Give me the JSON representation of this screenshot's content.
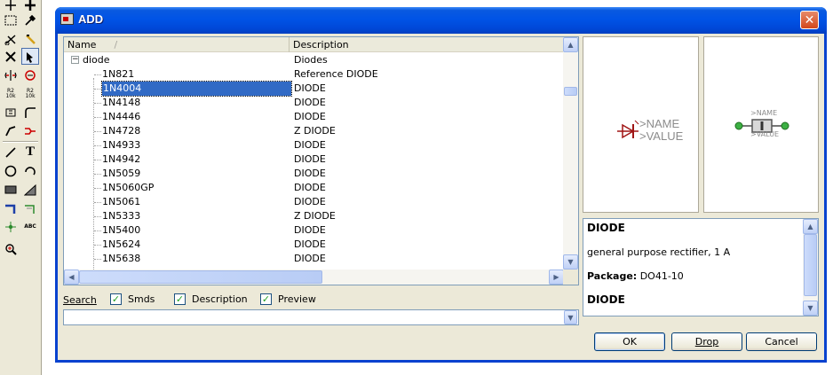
{
  "window": {
    "title": "ADD"
  },
  "toolbar": {
    "tools": [
      "move-icon",
      "copy-icon",
      "group-icon",
      "change-icon",
      "cut-icon",
      "ripup-icon",
      "delete-icon",
      "add-icon",
      "mirror-icon",
      "rotate-icon",
      "name-icon",
      "value-icon",
      "smash-icon",
      "miter-icon",
      "split-icon",
      "optimize-icon",
      "wire-icon",
      "text-icon",
      "circle-icon",
      "arc-icon",
      "rect-icon",
      "polygon-icon",
      "bus-icon",
      "net-icon",
      "junction-icon",
      "label-icon",
      "erc-icon"
    ],
    "name_glyph": "R2\n10k",
    "text_glyph": "T",
    "label_glyph": "ABC"
  },
  "list": {
    "columns": {
      "name": "Name",
      "description": "Description"
    },
    "sort_glyph": "/",
    "group": {
      "name": "diode",
      "description": "Diodes",
      "expander": "−"
    },
    "items": [
      {
        "name": "1N821",
        "description": "Reference DIODE"
      },
      {
        "name": "1N4004",
        "description": "DIODE",
        "selected": true
      },
      {
        "name": "1N4148",
        "description": "DIODE"
      },
      {
        "name": "1N4446",
        "description": "DIODE"
      },
      {
        "name": "1N4728",
        "description": "Z DIODE"
      },
      {
        "name": "1N4933",
        "description": "DIODE"
      },
      {
        "name": "1N4942",
        "description": "DIODE"
      },
      {
        "name": "1N5059",
        "description": "DIODE"
      },
      {
        "name": "1N5060GP",
        "description": "DIODE"
      },
      {
        "name": "1N5061",
        "description": "DIODE"
      },
      {
        "name": "1N5333",
        "description": "Z DIODE"
      },
      {
        "name": "1N5400",
        "description": "DIODE"
      },
      {
        "name": "1N5624",
        "description": "DIODE"
      },
      {
        "name": "1N5638",
        "description": "DIODE"
      }
    ]
  },
  "search": {
    "label": "Search",
    "value": "",
    "options": [
      {
        "label": "Smds",
        "checked": true
      },
      {
        "label": "Description",
        "checked": true
      },
      {
        "label": "Preview",
        "checked": true
      }
    ]
  },
  "symbol_preview": {
    "name_text": ">NAME",
    "value_text": ">VALUE",
    "color": "#a01515"
  },
  "package_preview": {
    "name_text": ">NAME",
    "value_text": ">VALUE",
    "pad_color": "#3cb043"
  },
  "info": {
    "title": "DIODE",
    "text": "general purpose rectifier, 1 A",
    "package_label": "Package:",
    "package_value": "DO41-10",
    "title2": "DIODE"
  },
  "buttons": {
    "ok": "OK",
    "drop": "Drop",
    "cancel": "Cancel"
  },
  "colors": {
    "title_bar": "#0053e6",
    "selection": "#316ac5",
    "dialog_bg": "#ece9d8"
  }
}
